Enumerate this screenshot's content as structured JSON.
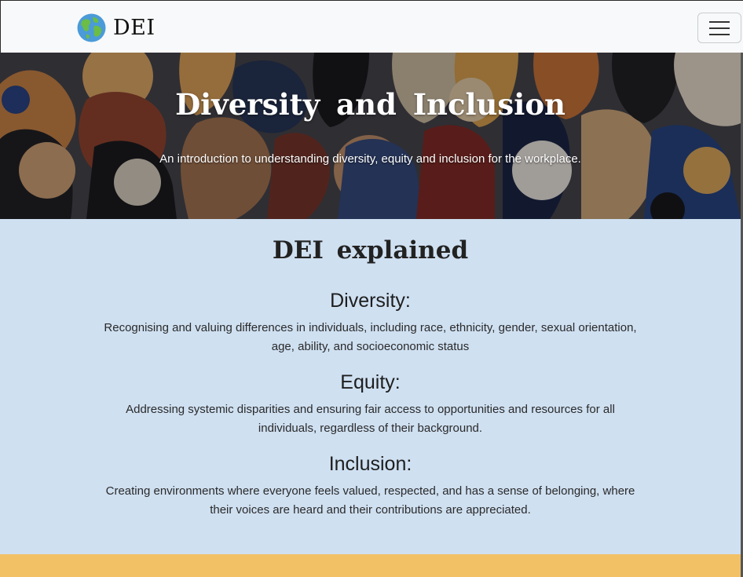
{
  "navbar": {
    "brand_text": "DEI",
    "brand_icon": "globe-icon",
    "menu_icon": "hamburger-menu-icon"
  },
  "hero": {
    "title": "Diversity and Inclusion",
    "subtitle": "An introduction to understanding diversity, equity and inclusion for the workplace."
  },
  "explain": {
    "title": "DEI explained",
    "terms": [
      {
        "heading": "Diversity:",
        "text": "Recognising and valuing differences in individuals, including race, ethnicity, gender, sexual orientation, age, ability, and socioeconomic status"
      },
      {
        "heading": "Equity:",
        "text": "Addressing systemic disparities and ensuring fair access to opportunities and resources for all individuals, regardless of their background."
      },
      {
        "heading": "Inclusion:",
        "text": "Creating environments where everyone feels valued, respected, and has a sense of belonging, where their voices are heard and their contributions are appreciated."
      }
    ]
  },
  "colors": {
    "navbar_bg": "#f8f9fa",
    "explain_bg": "#cfe0f1",
    "next_band_bg": "#f2c166"
  }
}
